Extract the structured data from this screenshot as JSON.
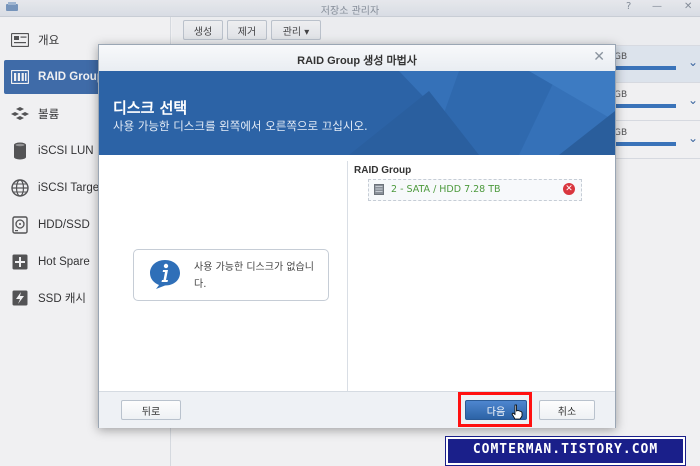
{
  "app": {
    "title": "저장소 관리자",
    "controls": [
      "?",
      "—",
      "✕"
    ]
  },
  "sidebar": {
    "items": [
      {
        "label": "개요",
        "icon": "overview-icon"
      },
      {
        "label": "RAID Group",
        "icon": "raid-group-icon",
        "active": true
      },
      {
        "label": "볼륨",
        "icon": "volume-icon"
      },
      {
        "label": "iSCSI LUN",
        "icon": "iscsi-lun-icon"
      },
      {
        "label": "iSCSI Target",
        "icon": "iscsi-target-icon"
      },
      {
        "label": "HDD/SSD",
        "icon": "hdd-icon"
      },
      {
        "label": "Hot Spare",
        "icon": "hot-spare-icon"
      },
      {
        "label": "SSD 캐시",
        "icon": "ssd-cache-icon"
      }
    ]
  },
  "toolbar": {
    "create_label": "생성",
    "remove_label": "제거",
    "manage_label": "관리 ▾"
  },
  "volumes": [
    {
      "size_suffix": "GB"
    },
    {
      "size_suffix": "GB"
    },
    {
      "size_suffix": "GB"
    }
  ],
  "dialog": {
    "title": "RAID Group 생성 마법사",
    "header_title": "디스크 선택",
    "header_subtitle": "사용 가능한 디스크를 왼쪽에서 오른쪽으로 끄십시오.",
    "right_pane_title": "RAID Group",
    "disk_entry": "2 - SATA / HDD 7.28 TB",
    "empty_message": "사용 가능한 디스크가 없습니다.",
    "back_label": "뒤로",
    "next_label": "다음",
    "cancel_label": "취소"
  },
  "watermark": {
    "text": "COMTERMAN.TISTORY.COM"
  },
  "colors": {
    "accent": "#2c63a6",
    "sidebar_active": "#3f6faf",
    "disk_text": "#4d9a3d",
    "highlight_frame": "#ff1010",
    "watermark_bg": "#1a1f8a"
  }
}
